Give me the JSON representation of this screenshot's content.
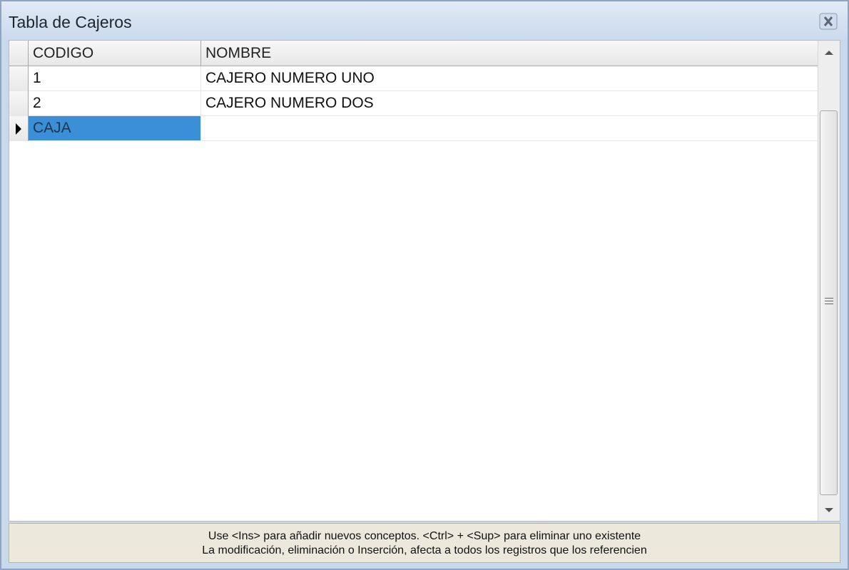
{
  "window": {
    "title": "Tabla de Cajeros"
  },
  "grid": {
    "columns": [
      "CODIGO",
      "NOMBRE"
    ],
    "rows": [
      {
        "codigo": "1",
        "nombre": "CAJERO NUMERO UNO",
        "current": false,
        "selected": false
      },
      {
        "codigo": "2",
        "nombre": "CAJERO NUMERO DOS",
        "current": false,
        "selected": false
      },
      {
        "codigo": "CAJA",
        "nombre": "",
        "current": true,
        "selected": true
      }
    ]
  },
  "footer": {
    "line1": "Use <Ins> para añadir nuevos conceptos. <Ctrl> + <Sup> para eliminar uno existente",
    "line2": "La modificación, eliminación o Inserción, afecta a todos los registros que los referencien"
  },
  "colors": {
    "selection": "#3a8fd6",
    "titlebar": "#cad9ec",
    "footer": "#ece9dc"
  },
  "icons": {
    "close": "close-icon",
    "row_indicator": "current-row-arrow-icon",
    "scroll_up": "scroll-up-arrow-icon",
    "scroll_down": "scroll-down-arrow-icon"
  }
}
